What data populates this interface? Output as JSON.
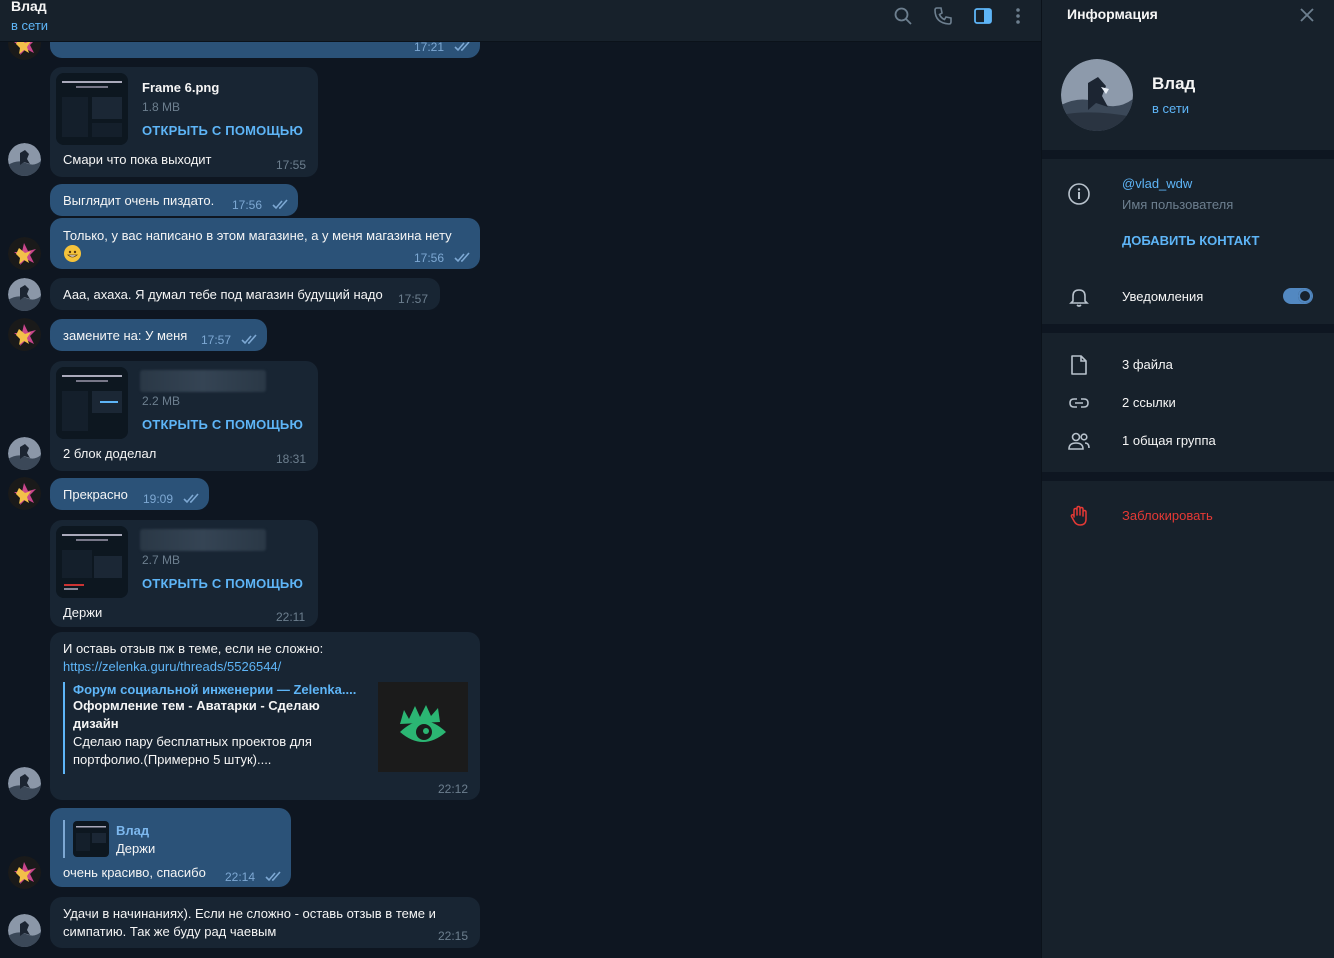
{
  "header": {
    "name": "Влад",
    "status": "в сети"
  },
  "messages": {
    "m0": {
      "time": "17:21"
    },
    "m1": {
      "file_name": "Frame 6.png",
      "file_size": "1.8 MB",
      "open": "ОТКРЫТЬ С ПОМОЩЬЮ",
      "caption": "Смари что пока выходит",
      "time": "17:55"
    },
    "m2": {
      "text": "Выглядит очень пиздато.",
      "time": "17:56"
    },
    "m3": {
      "text": "Только, у вас написано в этом магазине, а у меня магазина нету",
      "time": "17:56"
    },
    "m4": {
      "text": "Ааа, ахаха. Я думал тебе под магазин будущий надо",
      "time": "17:57"
    },
    "m5": {
      "text": "замените на: У меня",
      "time": "17:57"
    },
    "m6": {
      "file_size": "2.2 MB",
      "open": "ОТКРЫТЬ С ПОМОЩЬЮ",
      "caption": "2 блок доделал",
      "time": "18:31"
    },
    "m7": {
      "text": "Прекрасно",
      "time": "19:09"
    },
    "m8": {
      "file_size": "2.7 MB",
      "open": "ОТКРЫТЬ С ПОМОЩЬЮ",
      "caption": "Держи",
      "time": "22:11"
    },
    "m9": {
      "text": "И оставь отзыв пж в теме, если не сложно:",
      "url": "https://zelenka.guru/threads/5526544/",
      "preview_site": "Форум социальной инженерии — Zelenka....",
      "preview_title_1": "Оформление тем - Аватарки - Сделаю",
      "preview_title_2": "дизайн",
      "preview_desc_1": "Сделаю пару бесплатных проектов для",
      "preview_desc_2": "портфолио.(Примерно 5 штук)....",
      "time": "22:12"
    },
    "m10": {
      "reply_name": "Влад",
      "reply_text": "Держи",
      "text": "очень красиво, спасибо",
      "time": "22:14"
    },
    "m11": {
      "line1": "Удачи в начинаниях). Если не сложно - оставь отзыв в теме и",
      "line2": "симпатию. Так же буду рад чаевым",
      "time": "22:15"
    }
  },
  "info": {
    "title": "Информация",
    "name": "Влад",
    "status": "в сети",
    "username": "@vlad_wdw",
    "username_label": "Имя пользователя",
    "add_contact": "ДОБАВИТЬ КОНТАКТ",
    "notifications": "Уведомления",
    "notifications_on": true,
    "files": "3 файла",
    "links": "2 ссылки",
    "groups": "1 общая группа",
    "block": "Заблокировать"
  },
  "colors": {
    "accent": "#5eb5f7",
    "outgoing_bubble": "#2b5278",
    "incoming_bubble": "#182533",
    "danger": "#e53935"
  }
}
